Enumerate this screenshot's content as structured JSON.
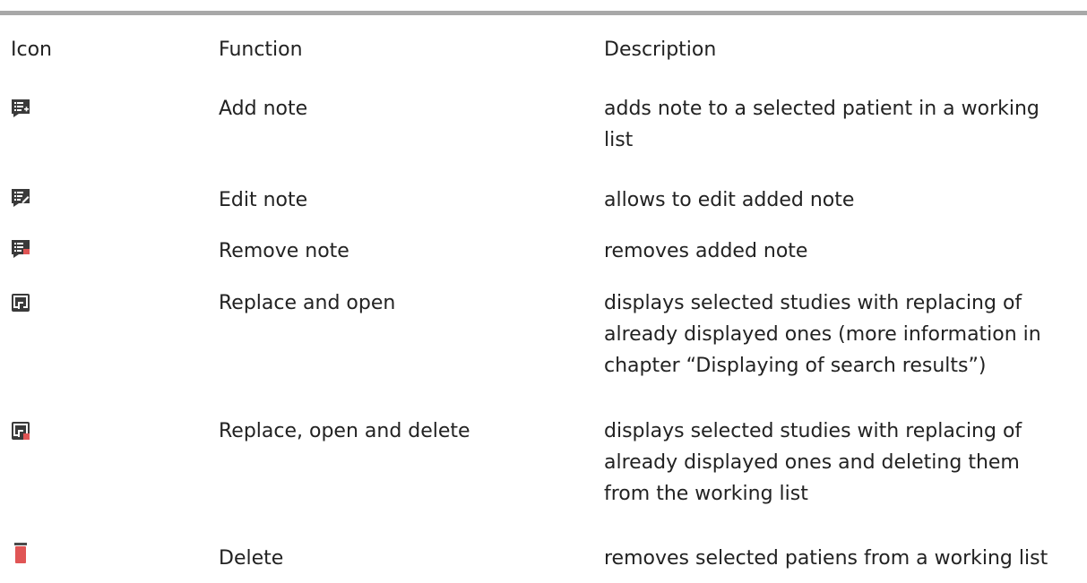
{
  "table": {
    "headers": {
      "icon": "Icon",
      "function": "Function",
      "description": "Description"
    },
    "rows": [
      {
        "icon": "add-note-icon",
        "function": "Add note",
        "description": [
          "adds note to a selected patient in a working",
          "list"
        ]
      },
      {
        "icon": "edit-note-icon",
        "function": "Edit note",
        "description": [
          "allows to edit added note"
        ]
      },
      {
        "icon": "remove-note-icon",
        "function": "Remove note",
        "description": [
          "removes added note"
        ]
      },
      {
        "icon": "replace-and-open-icon",
        "function": "Replace and open",
        "description": [
          "displays selected studies with replacing of",
          "already displayed ones (more information in",
          "chapter “Displaying of search results”)"
        ]
      },
      {
        "icon": "replace-open-delete-icon",
        "function": "Replace, open and delete",
        "description": [
          "displays selected studies with replacing of",
          "already displayed ones and deleting them",
          "from the working list"
        ]
      },
      {
        "icon": "trash-icon",
        "function": "Delete",
        "description": [
          "removes selected patiens from a working list"
        ]
      }
    ]
  },
  "colors": {
    "icon_dark": "#3a3a3a",
    "accent_red": "#e05555",
    "rule": "#a8a8a8"
  }
}
